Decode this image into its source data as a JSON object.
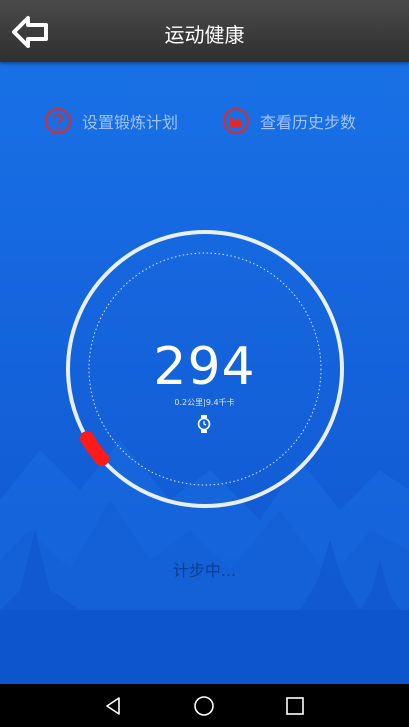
{
  "header": {
    "title": "运动健康",
    "back_icon": "back-arrow-icon"
  },
  "actions": {
    "plan_label": "设置锻炼计划",
    "plan_icon": "question-circle-icon",
    "history_label": "查看历史步数",
    "history_icon": "area-chart-circle-icon"
  },
  "progress": {
    "steps": "294",
    "detail": "0.2公里|9.4千卡",
    "watch_icon": "watch-icon"
  },
  "status_text": "计步中...",
  "colors": {
    "header": "#3a3a3a",
    "background": "#1565dd",
    "action_red": "#e02a2a",
    "progress_red": "#ff1a1a",
    "label": "#9fc3ff"
  },
  "navbar": {
    "back": "nav-back-icon",
    "home": "nav-home-icon",
    "recent": "nav-recent-icon"
  }
}
